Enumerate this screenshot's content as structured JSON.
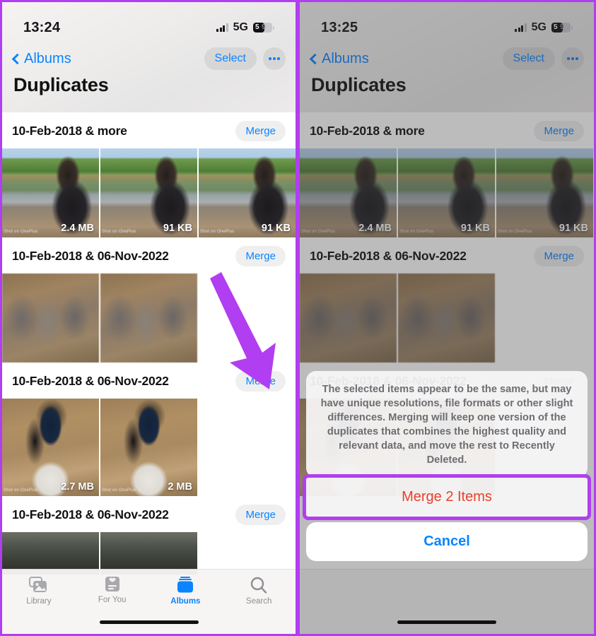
{
  "annotation": {
    "accent_color": "#b13ef0",
    "arrow_name": "pointer-arrow-to-merge"
  },
  "left_phone": {
    "status": {
      "time": "13:24",
      "network": "5G",
      "battery_percent": "59"
    },
    "nav": {
      "back_label": "Albums",
      "select_label": "Select",
      "more_label": "•••"
    },
    "title": "Duplicates",
    "groups": [
      {
        "title": "10-Feb-2018 & more",
        "merge_label": "Merge",
        "photos": [
          {
            "size": "2.4 MB",
            "watermark": "Shot on OnePlus",
            "style": "ph-lake"
          },
          {
            "size": "91 KB",
            "watermark": "Shot on OnePlus",
            "style": "ph-lake"
          },
          {
            "size": "91 KB",
            "watermark": "Shot on OnePlus",
            "style": "ph-lake"
          }
        ]
      },
      {
        "title": "10-Feb-2018 & 06-Nov-2022",
        "merge_label": "Merge",
        "photos": [
          {
            "size": "",
            "watermark": "",
            "style": "ph-blur"
          },
          {
            "size": "",
            "watermark": "",
            "style": "ph-blur"
          }
        ]
      },
      {
        "title": "10-Feb-2018 & 06-Nov-2022",
        "merge_label": "Merge",
        "photos": [
          {
            "size": "2.7 MB",
            "watermark": "Shot on OnePlus",
            "style": "ph-book"
          },
          {
            "size": "2 MB",
            "watermark": "Shot on OnePlus",
            "style": "ph-book"
          }
        ]
      },
      {
        "title": "10-Feb-2018 & 06-Nov-2022",
        "merge_label": "Merge",
        "photos": [
          {
            "size": "",
            "watermark": "",
            "style": "ph-dark"
          },
          {
            "size": "",
            "watermark": "",
            "style": "ph-dark"
          }
        ]
      }
    ],
    "tabs": [
      {
        "label": "Library",
        "icon": "library-icon",
        "active": false
      },
      {
        "label": "For You",
        "icon": "for-you-icon",
        "active": false
      },
      {
        "label": "Albums",
        "icon": "albums-icon",
        "active": true
      },
      {
        "label": "Search",
        "icon": "search-icon",
        "active": false
      }
    ]
  },
  "right_phone": {
    "status": {
      "time": "13:25",
      "network": "5G",
      "battery_percent": "59"
    },
    "nav": {
      "back_label": "Albums",
      "select_label": "Select",
      "more_label": "•••"
    },
    "title": "Duplicates",
    "groups": [
      {
        "title": "10-Feb-2018 & more",
        "merge_label": "Merge",
        "photos": [
          {
            "size": "2.4 MB",
            "watermark": "Shot on OnePlus",
            "style": "ph-lake"
          },
          {
            "size": "91 KB",
            "watermark": "Shot on OnePlus",
            "style": "ph-lake"
          },
          {
            "size": "91 KB",
            "watermark": "Shot on OnePlus",
            "style": "ph-lake"
          }
        ]
      },
      {
        "title": "10-Feb-2018 & 06-Nov-2022",
        "merge_label": "Merge",
        "photos": [
          {
            "size": "",
            "watermark": "",
            "style": "ph-blur"
          },
          {
            "size": "",
            "watermark": "",
            "style": "ph-blur"
          }
        ]
      },
      {
        "title": "10-Feb-2018 & 06-Nov-2022",
        "merge_label": "Merge",
        "photos": [
          {
            "size": "",
            "watermark": "",
            "style": "ph-book"
          },
          {
            "size": "",
            "watermark": "",
            "style": "ph-book"
          }
        ]
      }
    ],
    "action_sheet": {
      "message": "The selected items appear to be the same, but may have unique resolutions, file formats or other slight differences. Merging will keep one version of the duplicates that combines the highest quality and relevant data, and move the rest to Recently Deleted.",
      "confirm_label": "Merge 2 Items",
      "cancel_label": "Cancel",
      "confirm_color": "#e8402a",
      "cancel_color": "#0a84ff"
    }
  }
}
